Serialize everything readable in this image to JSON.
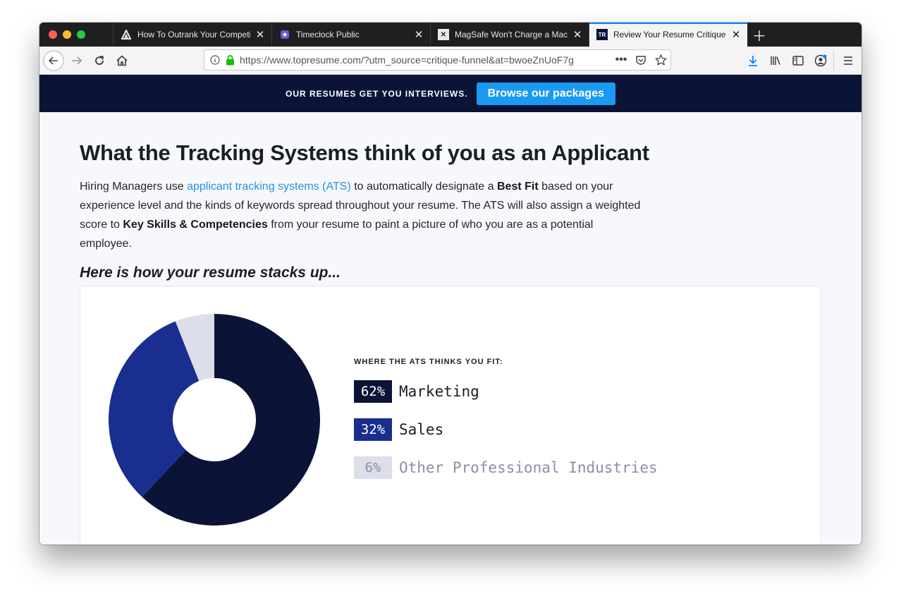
{
  "browser": {
    "tabs": [
      {
        "title": "How To Outrank Your Competiti",
        "favicon": "A"
      },
      {
        "title": "Timeclock Public",
        "favicon": "T"
      },
      {
        "title": "MagSafe Won't Charge a MacBo",
        "favicon": "X"
      },
      {
        "title": "Review Your Resume Critique |",
        "favicon": "TR"
      }
    ],
    "active_tab": 3,
    "url": "https://www.topresume.com/?utm_source=critique-funnel&at=bwoeZnUoF7g"
  },
  "promo": {
    "tagline": "OUR RESUMES GET YOU INTERVIEWS.",
    "cta_label": "Browse our packages"
  },
  "page": {
    "heading": "What the Tracking Systems think of you as an Applicant",
    "para": {
      "p1": "Hiring Managers use ",
      "link": "applicant tracking systems (ATS)",
      "p2": " to automatically designate a ",
      "b1": "Best Fit",
      "p3": " based on your experience level and the kinds of keywords spread throughout your resume. The ATS will also assign a weighted score to ",
      "b2": "Key Skills & Competencies",
      "p4": " from your resume to paint a picture of who you are as a potential employee."
    },
    "subheading": "Here is how your resume stacks up..."
  },
  "chart_data": {
    "type": "pie",
    "title": "WHERE THE ATS THINKS YOU FIT:",
    "categories": [
      "Marketing",
      "Sales",
      "Other Professional Industries"
    ],
    "values": [
      62,
      32,
      6
    ],
    "labels": [
      "62%",
      "32%",
      "6%"
    ],
    "colors": [
      "#0b1437",
      "#1a2e8f",
      "#dcdfea"
    ]
  },
  "colors": {
    "brand_navy": "#0b1437",
    "accent_blue": "#1a9af0",
    "link_blue": "#2592e6"
  }
}
